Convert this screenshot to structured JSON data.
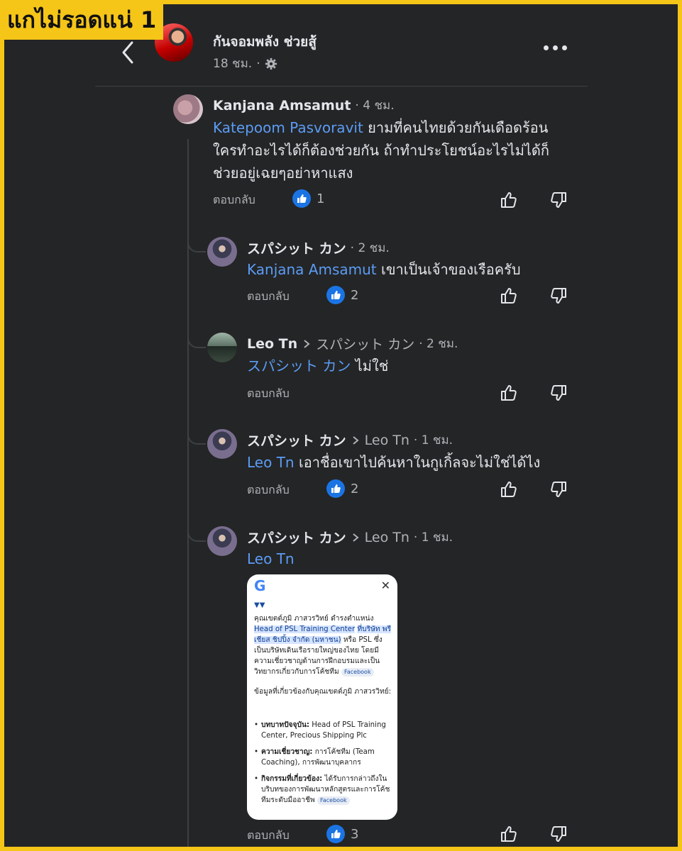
{
  "badge": "แกไม่รอดแน่ 1",
  "post": {
    "author": "กันจอมพลัง ช่วยสู้",
    "time": "18 ชม.",
    "separator": "·"
  },
  "comments": [
    {
      "author": "Kanjana Amsamut",
      "time": "4 ชม.",
      "mention": "Katepoom Pasvoravit",
      "lines": [
        " ยามที่คนไทยด้วยกันเดือดร้อน",
        "ใครทำอะไรได้ก็ต้องช่วยกัน ถ้าทำประโยชน์อะไรไม่ได้ก็",
        "ช่วยอยู่เฉยๆอย่าหาแสง"
      ],
      "reply": "ตอบกลับ",
      "likes": "1"
    },
    {
      "author": "スパシット カン",
      "time": "2 ชม.",
      "mention": "Kanjana Amsamut",
      "text": " เขาเป็นเจ้าของเรือครับ",
      "reply": "ตอบกลับ",
      "likes": "2"
    },
    {
      "author": "Leo Tn",
      "reply_to": "スパシット カン",
      "time": "2 ชม.",
      "mention": "スパシット カン",
      "text": " ไม่ใช่",
      "reply": "ตอบกลับ"
    },
    {
      "author": "スパシット カン",
      "reply_to": "Leo Tn",
      "time": "1 ชม.",
      "mention": "Leo Tn",
      "text": " เอาชื่อเขาไปค้นหาในกูเกิ้ลจะไม่ใช่ได้ไง",
      "reply": "ตอบกลับ",
      "likes": "2"
    },
    {
      "author": "スパシット カン",
      "reply_to": "Leo Tn",
      "time": "1 ชม.",
      "mention": "Leo Tn",
      "reply": "ตอบกลับ",
      "likes": "3"
    }
  ],
  "screenshot": {
    "logo": "G",
    "close": "✕",
    "p1_a": "คุณเขตต์ภูมิ ภาสวรวิทย์ ดำรงตำแหน่ง",
    "p1_hl1": "Head of PSL Training Center",
    "p1_hl2": "ที่บริษัท พรีเชียส ชิปปิ้ง จำกัด (มหาชน)",
    "p1_b": " หรือ PSL ซึ่งเป็นบริษัทเดินเรือรายใหญ่ของไทย โดยมีความเชี่ยวชาญด้านการฝึกอบรมและเป็นวิทยากรเกี่ยวกับการโค้ชทีม",
    "fb": "Facebook",
    "p2": "ข้อมูลที่เกี่ยวข้องกับคุณเขตต์ภูมิ ภาสวรวิทย์:",
    "li1_b": "บทบาทปัจจุบัน:",
    "li1": " Head of PSL Training Center, Precious Shipping Plc",
    "li2_b": "ความเชี่ยวชาญ:",
    "li2": " การโค้ชทีม (Team Coaching), การพัฒนาบุคลากร",
    "li3_b": "กิจกรรมที่เกี่ยวข้อง:",
    "li3": " ได้รับการกล่าวถึงในบริบทของการพัฒนาหลักสูตรและการโค้ชทีมระดับมืออาชีพ"
  },
  "colors": {
    "background": "#242526",
    "mention": "#5b9cf5",
    "like": "#1b74e4",
    "frame": "#f5c518"
  }
}
